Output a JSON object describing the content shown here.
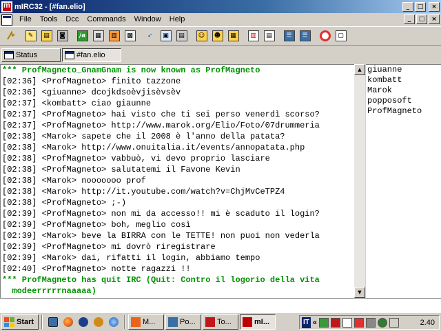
{
  "window": {
    "title": "mIRC32 - [#fan.elio]",
    "buttons": {
      "minimize": "_",
      "maximize": "□",
      "close": "×"
    }
  },
  "menu": {
    "items": [
      "File",
      "Tools",
      "Dcc",
      "Commands",
      "Window",
      "Help"
    ]
  },
  "toolbar": {
    "icons": [
      "connect-icon",
      "options-icon",
      "address-book-icon",
      "remote-icon",
      "aliases-icon",
      "popups-icon",
      "scripts-icon",
      "channels-list-icon",
      "send-icon",
      "chat-icon",
      "dcc-options-icon",
      "notify-icon",
      "urls-icon",
      "colors-icon",
      "tile-icon",
      "cascade-icon",
      "tile-horizontal-icon",
      "help-icon"
    ]
  },
  "switchbar": {
    "tabs": [
      "Status",
      "#fan.elio"
    ],
    "active": "#fan.elio"
  },
  "chat": {
    "lines": [
      {
        "text": "*** ProfMagneto_GnamGnam is now known as ProfMagneto",
        "type": "system"
      },
      {
        "text": "[02:36] <ProfMagneto> finito tazzone",
        "type": "msg"
      },
      {
        "text": "[02:36] <giuanne> dcojkdsoèvjisèvsèv",
        "type": "msg"
      },
      {
        "text": "[02:37] <kombatt> ciao giaunne",
        "type": "msg"
      },
      {
        "text": "[02:37] <ProfMagneto> hai visto che ti sei perso venerdì scorso?",
        "type": "msg"
      },
      {
        "text": "[02:37] <ProfMagneto> http://www.marok.org/Elio/Foto/07drummeria",
        "type": "msg"
      },
      {
        "text": "[02:38] <Marok> sapete che il 2008 è l'anno della patata?",
        "type": "msg"
      },
      {
        "text": "[02:38] <Marok> http://www.onuitalia.it/events/annopatata.php",
        "type": "msg"
      },
      {
        "text": "[02:38] <ProfMagneto> vabbuò, vi devo proprio lasciare",
        "type": "msg"
      },
      {
        "text": "[02:38] <ProfMagneto> salutatemi il Favone Kevin",
        "type": "msg"
      },
      {
        "text": "[02:38] <Marok> nooooooo prof",
        "type": "msg"
      },
      {
        "text": "[02:38] <Marok> http://it.youtube.com/watch?v=ChjMvCeTPZ4",
        "type": "msg"
      },
      {
        "text": "[02:38] <ProfMagneto> ;-)",
        "type": "msg"
      },
      {
        "text": "[02:39] <ProfMagneto> non mi da accesso!! mi è scaduto il login?",
        "type": "msg"
      },
      {
        "text": "[02:39] <ProfMagneto> boh, meglio così",
        "type": "msg"
      },
      {
        "text": "[02:39] <Marok> beve la BIRRA con le TETTE! non puoi non vederla",
        "type": "msg"
      },
      {
        "text": "[02:39] <ProfMagneto> mi dovrò riregistrare",
        "type": "msg"
      },
      {
        "text": "[02:39] <Marok> dai, rifatti il login, abbiamo tempo",
        "type": "msg"
      },
      {
        "text": "[02:40] <ProfMagneto> notte ragazzi !!",
        "type": "msg"
      },
      {
        "text": "*** ProfMagneto has quit IRC (Quit: Contro il logorio della vita",
        "type": "system"
      },
      {
        "text": "  modeerrrrrnaaaaa)",
        "type": "system"
      }
    ]
  },
  "nicklist": [
    "giuanne",
    "kombatt",
    "Marok",
    "popposoft",
    "ProfMagneto"
  ],
  "taskbar": {
    "start_label": "Start",
    "quick_launch": [
      "show-desktop-icon",
      "firefox-icon",
      "download-icon",
      "app-icon",
      "explorer-icon"
    ],
    "tasks": [
      {
        "label": "M...",
        "color": "#e8631c"
      },
      {
        "label": "Po...",
        "color": "#3a6ea5"
      },
      {
        "label": "To...",
        "color": "#c01818"
      },
      {
        "label": "mI...",
        "color": "#c00000"
      }
    ],
    "active_task": "mI...",
    "tray": {
      "language": "IT",
      "chevron": "«",
      "clock": "2.40"
    }
  },
  "colors": {
    "system_text": "#009300",
    "title_gradient_start": "#0a246a",
    "face": "#d4d0c8"
  }
}
